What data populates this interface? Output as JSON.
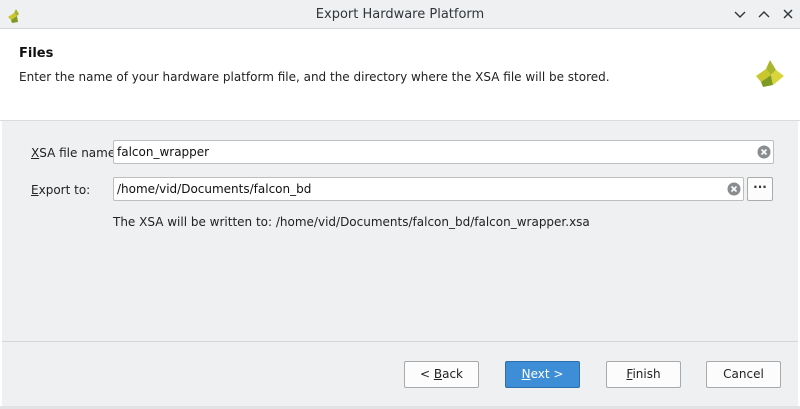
{
  "window": {
    "title": "Export Hardware Platform",
    "buttons": [
      "minimize",
      "maximize",
      "close"
    ]
  },
  "header": {
    "title": "Files",
    "description": "Enter the name of your hardware platform file, and the directory where the XSA file will be stored."
  },
  "form": {
    "xsa_name": {
      "label": "XSA file name:",
      "label_mnemonic": "X",
      "label_rest": "SA file name:",
      "value": "falcon_wrapper"
    },
    "export_to": {
      "label": "Export to:",
      "label_mnemonic": "E",
      "label_rest": "xport to:",
      "value": "/home/vid/Documents/falcon_bd"
    },
    "browse_label": "···",
    "written_to": "The XSA will be written to: /home/vid/Documents/falcon_bd/falcon_wrapper.xsa"
  },
  "footer": {
    "back": {
      "label": "< Back",
      "pre": "< ",
      "mnemonic": "B",
      "post": "ack"
    },
    "next": {
      "label": "Next >",
      "pre": "",
      "mnemonic": "N",
      "post": "ext >"
    },
    "finish": {
      "label": "Finish",
      "pre": "",
      "mnemonic": "F",
      "post": "inish"
    },
    "cancel": {
      "label": "Cancel"
    }
  },
  "colors": {
    "primary_button": "#3d8ed6",
    "dialog_bg": "#eff0f1",
    "logo_yellow": "#c9c72d",
    "logo_green": "#7f9a22"
  },
  "icons": {
    "app": "xilinx-logo-icon",
    "header_logo": "xilinx-logo-icon",
    "clear": "clear-circle-icon"
  }
}
